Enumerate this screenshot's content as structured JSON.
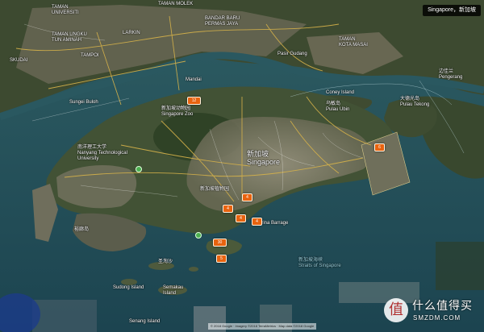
{
  "search": {
    "query": "Singapore，新加坡"
  },
  "markers": [
    "12",
    "4",
    "4",
    "4",
    "4",
    "6",
    "30",
    "5"
  ],
  "labels": {
    "taman_universiti": "TAMAN\nUNIVERSITI",
    "taman_ungku": "TAMAN UNGKU\nTUN AMINAH",
    "taman_molek": "TAMAN MOLEK",
    "bandar_baru": "BANDAR BARU\nPERMAS JAYA",
    "kota_masai": "TAMAN\nKOTA MASAI",
    "pasir_gudang": "Pasir Gudang",
    "larkin": "LARKIN",
    "skudai": "SKUDAI",
    "tampoi": "TAMPOI",
    "sungei_buloh": "Sungei Buloh",
    "mandai": "Mandai",
    "pulau_ubin": "乌敏岛\nPulau Ubin",
    "pengerang": "边佳兰\nPengerang",
    "tekong": "大德光岛\nPulau Tekong",
    "singapore": "新加坡\nSingapore",
    "nanyang": "南洋理工大学\nNanyang Technological\nUniversity",
    "singapore_zoo": "新加坡动物园\nSingapore Zoo",
    "botanic": "新加坡植物园",
    "marina": "Marina Barrage",
    "straits": "新加坡海峡\nStraits of Singapore",
    "sentosa": "圣淘沙",
    "jurong": "裕廊岛",
    "sudong": "Sudong Island",
    "semakau": "Semakau\nIsland",
    "senang": "Senang Island",
    "coney": "Coney Island"
  },
  "attribution": "© 2018 Google · Imagery ©2018 TerraMetrics · Map data ©2018 Google",
  "watermark": {
    "logo_glyph": "值",
    "chinese": "什么值得买",
    "english": "SMZDM.COM"
  },
  "colors": {
    "marker": "#e8630f",
    "water": "#1f4f5a",
    "land": "#3c4a2f",
    "urban": "#8a8370"
  }
}
